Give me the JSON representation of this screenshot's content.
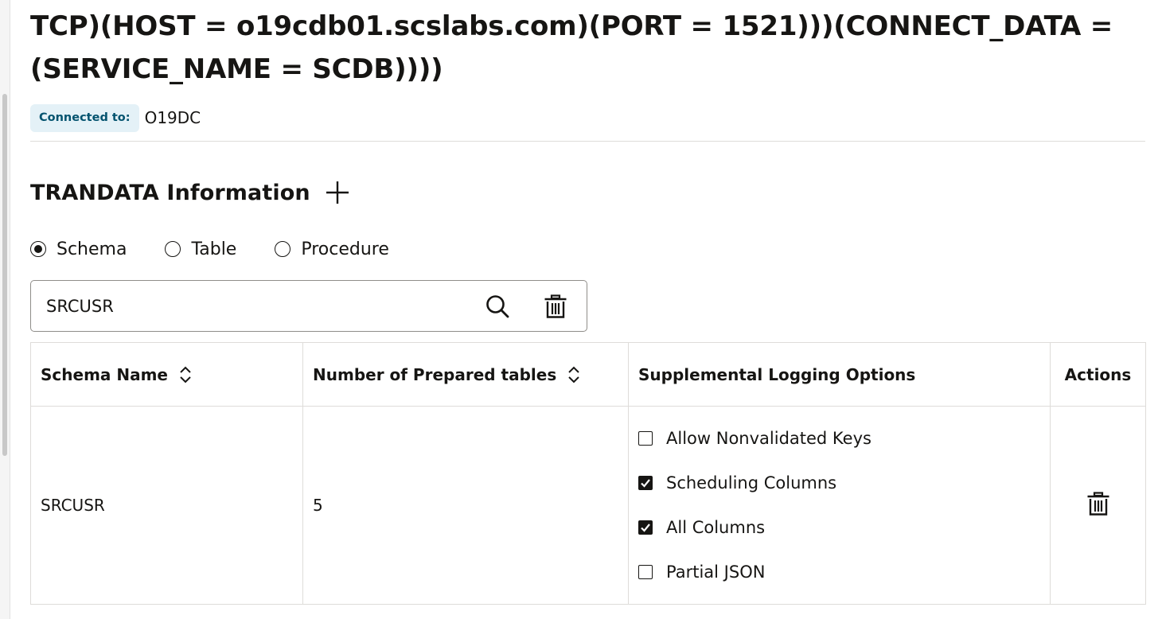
{
  "connection": {
    "string_line1": "TCP)(HOST = o19cdb01.scslabs.com)(PORT = 1521)))(CONNECT_DATA =",
    "string_line2": "(SERVICE_NAME = SCDB))))",
    "connected_label": "Connected to:",
    "connected_value": "O19DC"
  },
  "trandata": {
    "title": "TRANDATA Information",
    "add_icon": "plus-icon",
    "radios": [
      {
        "label": "Schema",
        "selected": true
      },
      {
        "label": "Table",
        "selected": false
      },
      {
        "label": "Procedure",
        "selected": false
      }
    ],
    "search": {
      "value": "SRCUSR",
      "search_icon": "search-icon",
      "clear_icon": "trash-icon"
    },
    "table": {
      "headers": {
        "schema_name": "Schema Name",
        "prepared_tables": "Number of Prepared tables",
        "logging_options": "Supplemental Logging Options",
        "actions": "Actions"
      },
      "rows": [
        {
          "schema_name": "SRCUSR",
          "prepared_tables": "5",
          "options": [
            {
              "label": "Allow Nonvalidated Keys",
              "checked": false
            },
            {
              "label": "Scheduling Columns",
              "checked": true
            },
            {
              "label": "All Columns",
              "checked": true
            },
            {
              "label": "Partial JSON",
              "checked": false
            }
          ],
          "action_icon": "trash-icon"
        }
      ]
    }
  },
  "colors": {
    "text": "#161513",
    "badge_bg": "#e4f1f7",
    "badge_text": "#04536f",
    "border": "#dedcd9"
  }
}
